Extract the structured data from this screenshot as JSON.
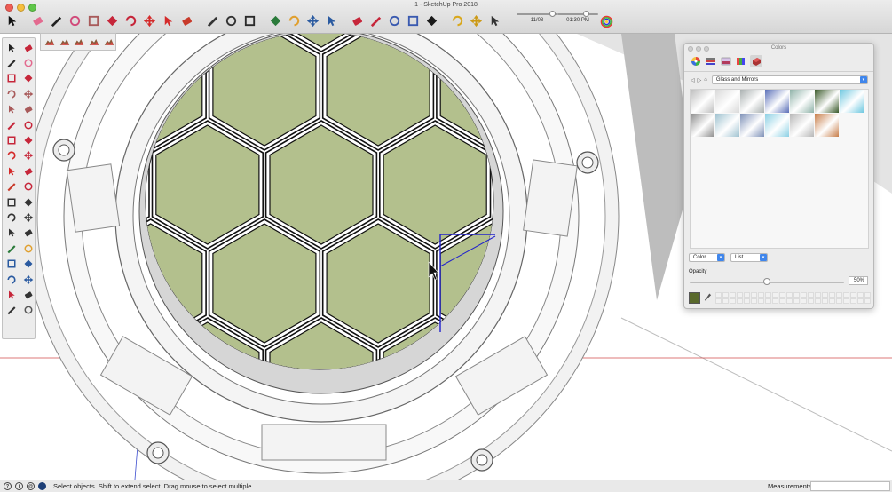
{
  "window": {
    "title": "1 - SketchUp Pro 2018"
  },
  "toolbar": {
    "tools": [
      {
        "name": "select-arrow-icon",
        "color": "#111111"
      },
      {
        "name": "eraser-icon",
        "color": "#e36a8f"
      },
      {
        "name": "pencil-line-icon",
        "color": "#222222"
      },
      {
        "name": "shapes-icon",
        "color": "#d14a7a"
      },
      {
        "name": "rectangle-icon",
        "color": "#a85a5a"
      },
      {
        "name": "push-pull-icon",
        "color": "#c6263a"
      },
      {
        "name": "offset-icon",
        "color": "#c6263a"
      },
      {
        "name": "move-icon",
        "color": "#d42a2a"
      },
      {
        "name": "rotate-icon",
        "color": "#d42a2a"
      },
      {
        "name": "scale-icon",
        "color": "#c83a2a"
      },
      {
        "name": "tape-measure-icon",
        "color": "#333333"
      },
      {
        "name": "text-icon",
        "color": "#333333"
      },
      {
        "name": "paint-bucket-icon",
        "color": "#2a2a2a"
      },
      {
        "name": "orbit-icon",
        "color": "#2a7a3a"
      },
      {
        "name": "pan-icon",
        "color": "#e0a030"
      },
      {
        "name": "zoom-icon",
        "color": "#2a5aa0"
      },
      {
        "name": "zoom-extents-icon",
        "color": "#2a5aa0"
      },
      {
        "name": "warehouse-icon",
        "color": "#c6263a"
      },
      {
        "name": "extension-warehouse-icon",
        "color": "#c6263a"
      },
      {
        "name": "components-icon",
        "color": "#3a5ab0"
      },
      {
        "name": "layout-icon",
        "color": "#3a5ab0"
      },
      {
        "name": "styles-icon",
        "color": "#1a1a1a"
      },
      {
        "name": "section-plane-icon",
        "color": "#d9a81e"
      },
      {
        "name": "hidden-line-icon",
        "color": "#cc9a16"
      },
      {
        "name": "shadow-icon",
        "color": "#333333"
      }
    ],
    "time_of_day": "01:30 PM",
    "date": "11/08",
    "date_slider_position": 0.8,
    "time_slider_position": 0.62
  },
  "colors_panel": {
    "title": "Colors",
    "library": "Glass and Mirrors",
    "mode_dropdown": "Color",
    "view_dropdown": "List",
    "opacity_label": "Opacity",
    "opacity_value": "50%",
    "opacity_fraction": 0.5,
    "current_color": "#5a6a2c",
    "swatches": [
      "#bdbdbd",
      "#d9d9d9",
      "#a9b0b0",
      "#5a6fb8",
      "#8fb2a8",
      "#3a5a2a",
      "#6fc8e0",
      "#8d8d8d",
      "#9fc2d0",
      "#7f92b8",
      "#8cd0e4",
      "#b7b7b7",
      "#c87e4a",
      ""
    ]
  },
  "status": {
    "message": "Select objects. Shift to extend select. Drag mouse to select multiple.",
    "measurements_label": "Measurements",
    "measurements_value": ""
  },
  "palette": {
    "tools": [
      "select-icon",
      "make-component-icon",
      "paint-bucket-icon",
      "eraser-icon",
      "line-icon",
      "freehand-icon",
      "rectangle-icon",
      "rotated-rectangle-icon",
      "circle-icon",
      "polygon-icon",
      "arc-icon",
      "two-point-arc-icon",
      "three-point-arc-icon",
      "pie-icon",
      "move-icon",
      "push-pull-icon",
      "rotate-icon",
      "follow-me-icon",
      "scale-icon",
      "offset-icon",
      "tape-measure-icon",
      "dimension-icon",
      "protractor-icon",
      "text-icon",
      "axes-icon",
      "3d-text-icon",
      "orbit-icon",
      "pan-icon",
      "zoom-icon",
      "zoom-window-icon",
      "zoom-extents-icon",
      "previous-view-icon",
      "position-camera-icon",
      "walk-icon",
      "look-around-icon",
      "section-plane-icon"
    ],
    "float_tools": [
      "sandbox-from-contours-icon",
      "sandbox-from-scratch-icon",
      "smoove-icon",
      "stamp-icon",
      "drape-icon"
    ]
  },
  "model": {
    "hex_fill_color": "#b3c08d",
    "hex_edge_color": "#111111",
    "selection_color": "#2222cc"
  }
}
